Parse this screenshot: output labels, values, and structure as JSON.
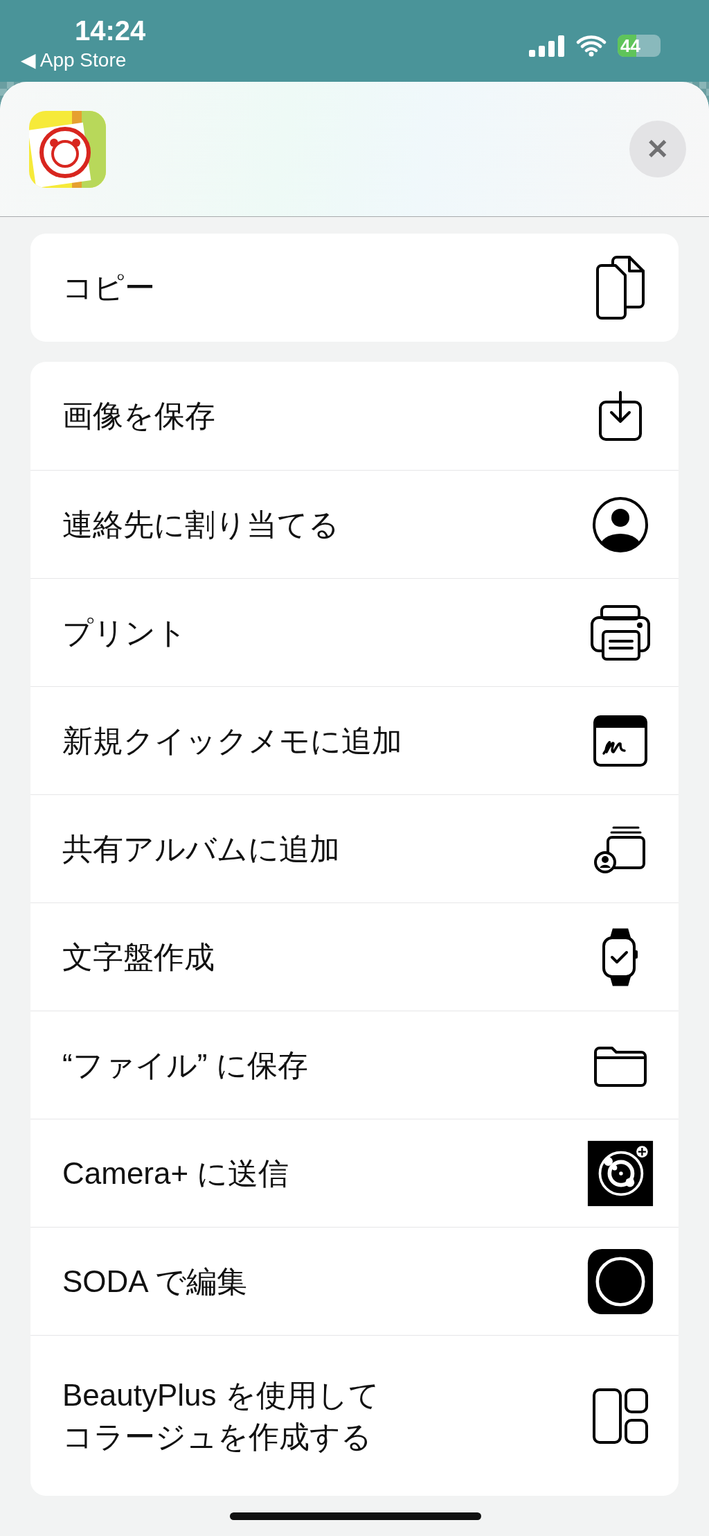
{
  "status_bar": {
    "time": "14:24",
    "back_link": "◀ App Store",
    "battery": "44"
  },
  "header": {
    "close": "✕"
  },
  "primary_actions": [
    {
      "label": "コピー"
    }
  ],
  "actions": [
    {
      "label": "画像を保存"
    },
    {
      "label": "連絡先に割り当てる"
    },
    {
      "label": "プリント"
    },
    {
      "label": "新規クイックメモに追加"
    },
    {
      "label": "共有アルバムに追加"
    },
    {
      "label": "文字盤作成"
    },
    {
      "label": "“ファイル” に保存"
    },
    {
      "label": "Camera+ に送信"
    },
    {
      "label": "SODA で編集"
    },
    {
      "label": "BeautyPlus を使用して",
      "continuation": "コラージュを作成する"
    }
  ]
}
